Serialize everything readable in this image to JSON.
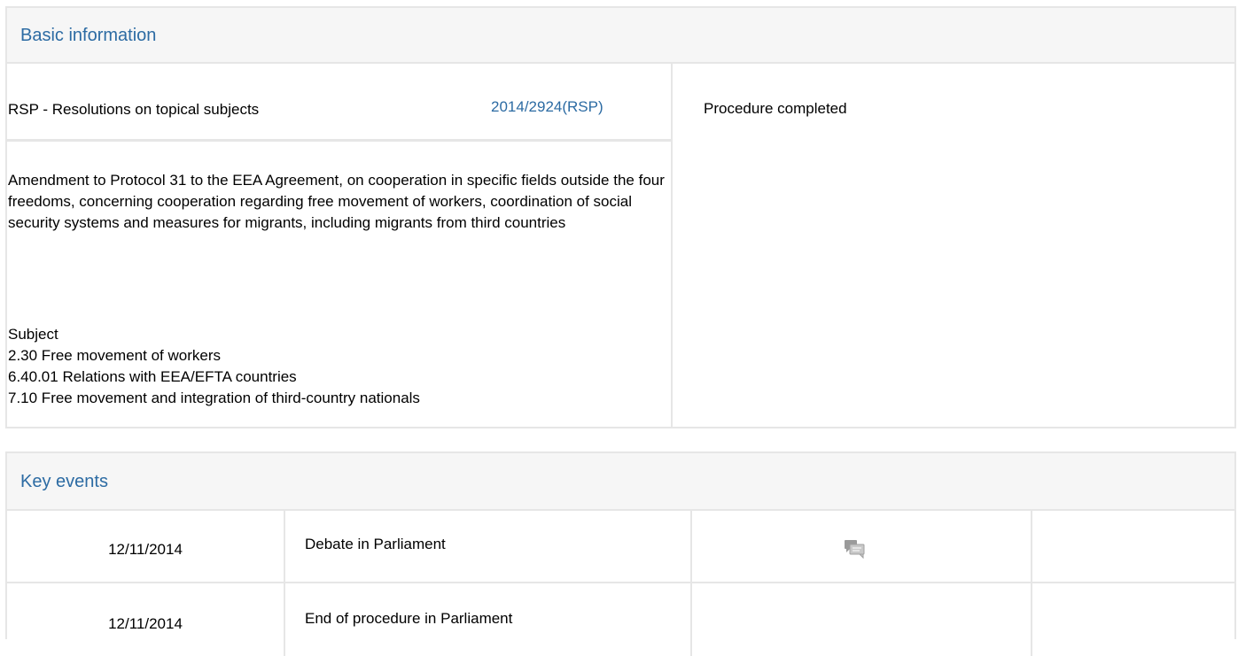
{
  "basic_info": {
    "heading": "Basic information",
    "procedure_type": "RSP - Resolutions on topical subjects",
    "procedure_reference": "2014/2924(RSP)",
    "status": "Procedure completed",
    "title": "Amendment to Protocol 31 to the EEA Agreement, on cooperation in specific fields outside the four freedoms, concerning cooperation regarding free movement of workers, coordination of social security systems and measures for migrants, including migrants from third countries",
    "subject_label": "Subject",
    "subjects": [
      "2.30 Free movement of workers",
      "6.40.01 Relations with EEA/EFTA countries",
      "7.10 Free movement and integration of third-country nationals"
    ]
  },
  "key_events": {
    "heading": "Key events",
    "rows": [
      {
        "date": "12/11/2014",
        "event": "Debate in Parliament",
        "icon": "debate-icon"
      },
      {
        "date": "12/11/2014",
        "event": "End of procedure in Parliament",
        "icon": ""
      }
    ]
  }
}
